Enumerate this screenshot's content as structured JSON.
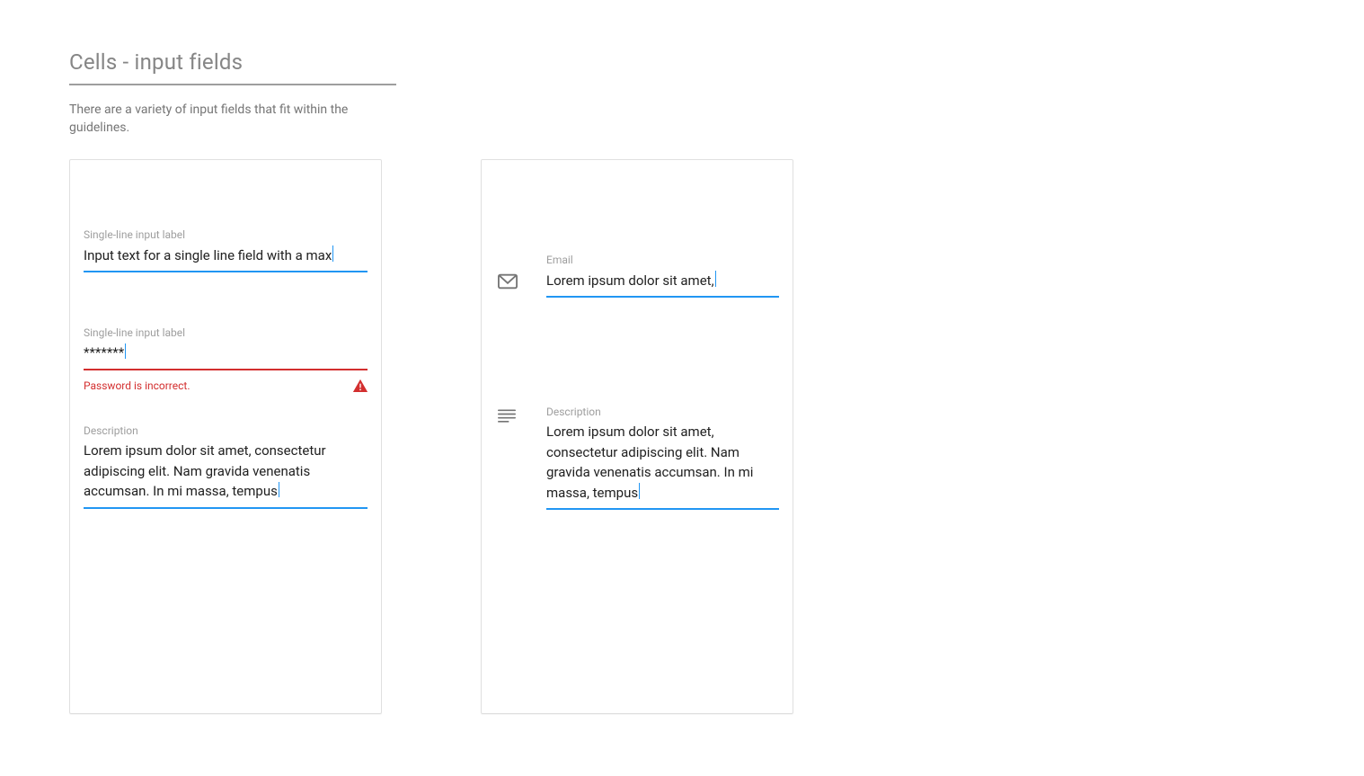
{
  "heading": "Cells - input fields",
  "intro": "There are a variety of input fields that fit within the guidelines.",
  "colors": {
    "primary": "#2196F3",
    "error": "#D32F2F"
  },
  "card1": {
    "field1": {
      "label": "Single-line input label",
      "value": "Input text for a single line field with a max",
      "state": "focused"
    },
    "field2": {
      "label": "Single-line input label",
      "value": "*******",
      "state": "error",
      "helper": "Password is incorrect.",
      "helper_icon": "warning-triangle"
    },
    "field3": {
      "label": "Description",
      "value": "Lorem ipsum dolor sit amet, consectetur adipiscing elit. Nam gravida venenatis accumsan. In mi massa, tempus",
      "state": "focused",
      "multiline": true
    }
  },
  "card2": {
    "field1": {
      "icon": "email-icon",
      "label": "Email",
      "value": "Lorem ipsum dolor sit amet,",
      "state": "focused"
    },
    "field2": {
      "icon": "paragraph-icon",
      "label": "Description",
      "value": "Lorem ipsum dolor sit amet, consectetur adipiscing elit. Nam gravida venenatis accumsan. In mi massa, tempus",
      "state": "focused",
      "multiline": true
    }
  }
}
